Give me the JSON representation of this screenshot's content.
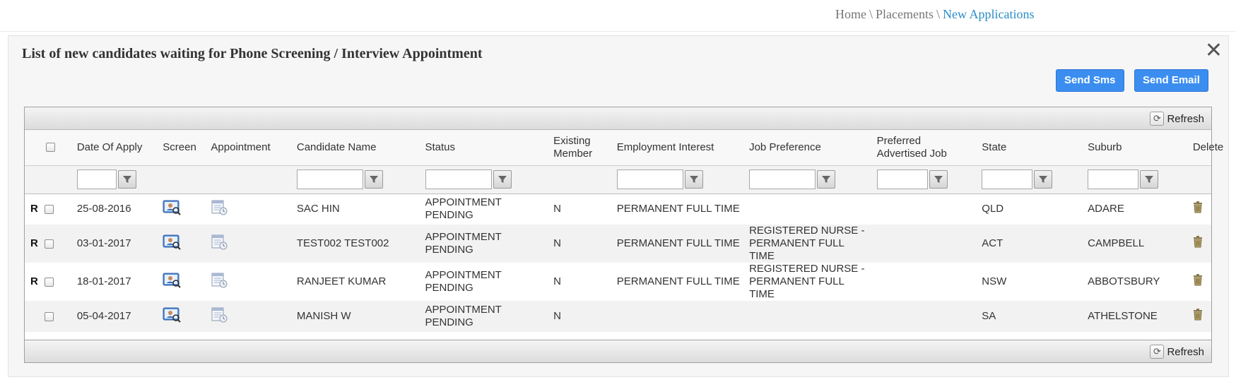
{
  "breadcrumb": {
    "home": "Home",
    "sep": "\\",
    "placements": "Placements",
    "current": "New Applications"
  },
  "panel": {
    "title": "List of new candidates waiting for Phone Screening / Interview Appointment",
    "close_label": "✕",
    "send_sms_label": "Send Sms",
    "send_email_label": "Send Email"
  },
  "grid": {
    "refresh_label": "Refresh",
    "columns": {
      "date": "Date Of Apply",
      "screen": "Screen",
      "appointment": "Appointment",
      "name": "Candidate Name",
      "status": "Status",
      "existing_1": "Existing",
      "existing_2": "Member",
      "employment": "Employment Interest",
      "job_pref": "Job Preference",
      "pref_adv_1": "Preferred",
      "pref_adv_2": "Advertised Job",
      "state": "State",
      "suburb": "Suburb",
      "delete": "Delete"
    },
    "rows": [
      {
        "flag": "R",
        "date": "25-08-2016",
        "name": "SAC HIN",
        "status_1": "APPOINTMENT",
        "status_2": "PENDING",
        "existing": "N",
        "employment": "PERMANENT FULL TIME",
        "job_pref_1": "",
        "job_pref_2": "",
        "state": "QLD",
        "suburb": "ADARE"
      },
      {
        "flag": "R",
        "date": "03-01-2017",
        "name": "TEST002 TEST002",
        "status_1": "APPOINTMENT",
        "status_2": "PENDING",
        "existing": "N",
        "employment": "PERMANENT FULL TIME",
        "job_pref_1": "REGISTERED NURSE -",
        "job_pref_2": "PERMANENT FULL TIME",
        "state": "ACT",
        "suburb": "CAMPBELL"
      },
      {
        "flag": "R",
        "date": "18-01-2017",
        "name": "RANJEET KUMAR",
        "status_1": "APPOINTMENT",
        "status_2": "PENDING",
        "existing": "N",
        "employment": "PERMANENT FULL TIME",
        "job_pref_1": "REGISTERED NURSE -",
        "job_pref_2": "PERMANENT FULL TIME",
        "state": "NSW",
        "suburb": "ABBOTSBURY"
      },
      {
        "flag": "",
        "date": "05-04-2017",
        "name": "MANISH W",
        "status_1": "APPOINTMENT",
        "status_2": "PENDING",
        "existing": "N",
        "employment": "",
        "job_pref_1": "",
        "job_pref_2": "",
        "state": "SA",
        "suburb": "ATHELSTONE"
      }
    ]
  },
  "icons": {
    "screen": "screen-candidate-icon",
    "appointment": "appointment-calendar-icon",
    "delete": "trash-icon",
    "filter": "filter-funnel-icon",
    "refresh": "refresh-icon"
  },
  "colors": {
    "accent": "#3b8ef0",
    "breadcrumb_active": "#2a8dc9"
  }
}
